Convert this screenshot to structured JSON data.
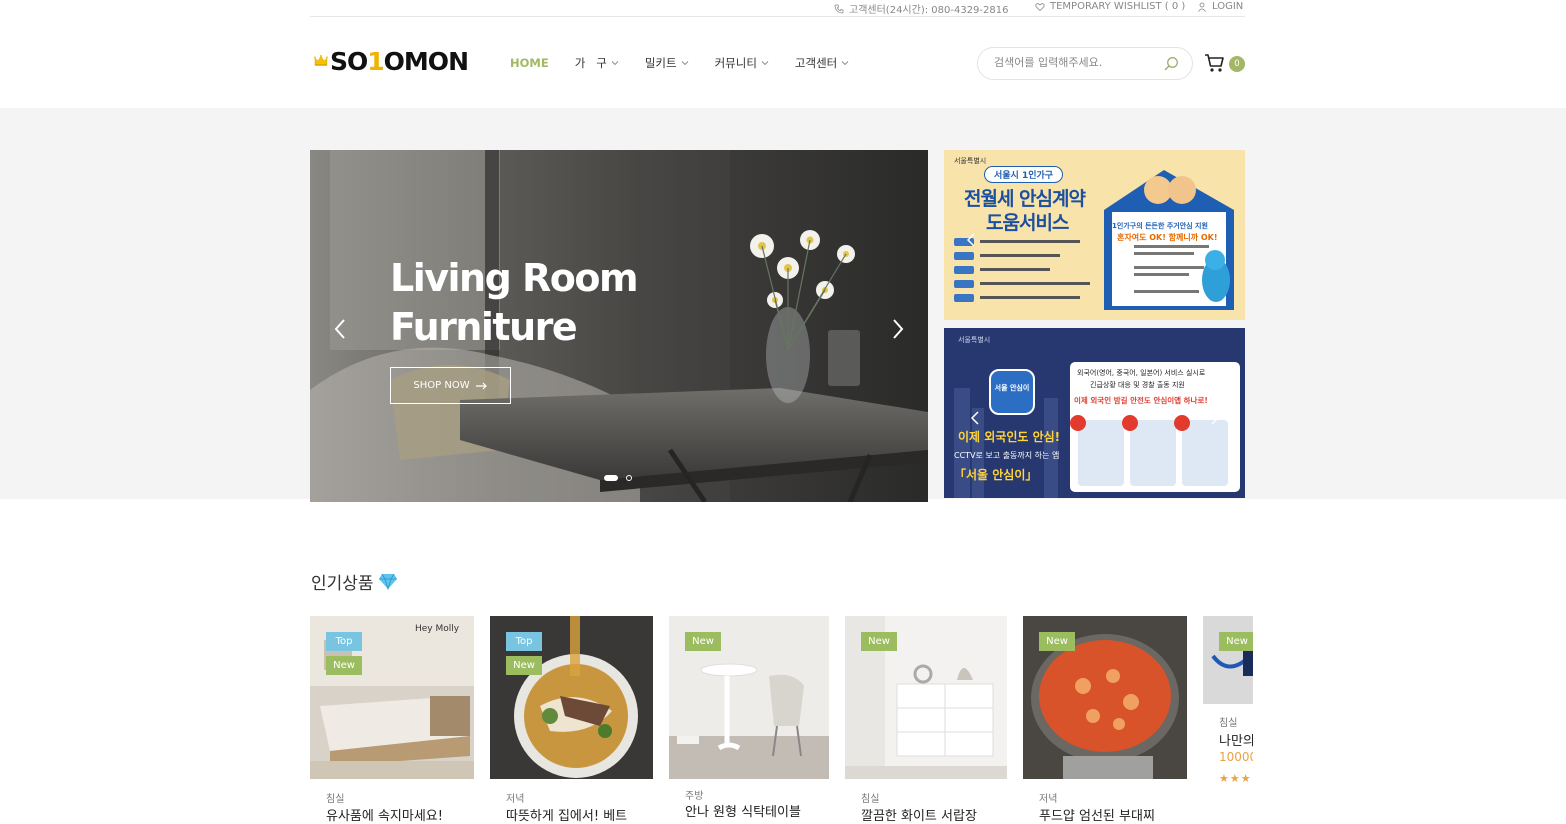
{
  "topbar": {
    "phone": "고객센터(24시간): 080-4329-2816",
    "wishlist": "TEMPORARY WISHLIST ( 0 )",
    "login": "LOGIN"
  },
  "header": {
    "logo": "SO1OMON",
    "nav": [
      {
        "label": "HOME",
        "dropdown": false
      },
      {
        "label": "가   구",
        "dropdown": true
      },
      {
        "label": "밀키트",
        "dropdown": true
      },
      {
        "label": "커뮤니티",
        "dropdown": true
      },
      {
        "label": "고객센터",
        "dropdown": true
      }
    ],
    "search_placeholder": "검색어를 입력해주세요.",
    "cart_count": "0"
  },
  "hero": {
    "title_line1": "Living Room",
    "title_line2": "Furniture",
    "cta": "SHOP NOW"
  },
  "banners": {
    "b1": {
      "badge": "서울시 1인가구",
      "title1": "전월세 안심계약",
      "title2": "도움서비스",
      "box_line1": "1인가구의 든든한 주거안심 지원",
      "box_line2": "혼자여도 OK! 함께니까 OK!",
      "org": "서울특별시"
    },
    "b2": {
      "org": "서울특별시",
      "app_name": "서울 안심이",
      "headline": "이제 외국인도 안심!",
      "sub": "CCTV로 보고 출동까지 하는 앱",
      "app_quote": "「서울 안심이」",
      "box_line1": "외국어(영어, 중국어, 일본어) 서비스 실시로",
      "box_line2": "긴급상황 대응 및 경찰 출동 지원",
      "box_line3": "이제 외국인 밤길 안전도 안심이앱 하나로!"
    }
  },
  "popular": {
    "title": "인기상품",
    "products": [
      {
        "category": "침실",
        "name": "유사품에 속지마세요!",
        "badges": [
          "Top",
          "New"
        ],
        "image_text": "Hey Molly"
      },
      {
        "category": "저녁",
        "name": "따뜻하게 집에서! 베트",
        "badges": [
          "Top",
          "New"
        ]
      },
      {
        "category": "주방",
        "name": "안나 원형 식탁테이블",
        "badges": [
          "New"
        ]
      },
      {
        "category": "침실",
        "name": "깔끔한 화이트 서랍장",
        "badges": [
          "New"
        ]
      },
      {
        "category": "저녁",
        "name": "푸드얍 엄선된 부대찌",
        "badges": [
          "New"
        ]
      },
      {
        "category": "침실",
        "name": "나만의",
        "badges": [
          "New"
        ],
        "price": "10000",
        "stars": "★★★"
      }
    ]
  }
}
